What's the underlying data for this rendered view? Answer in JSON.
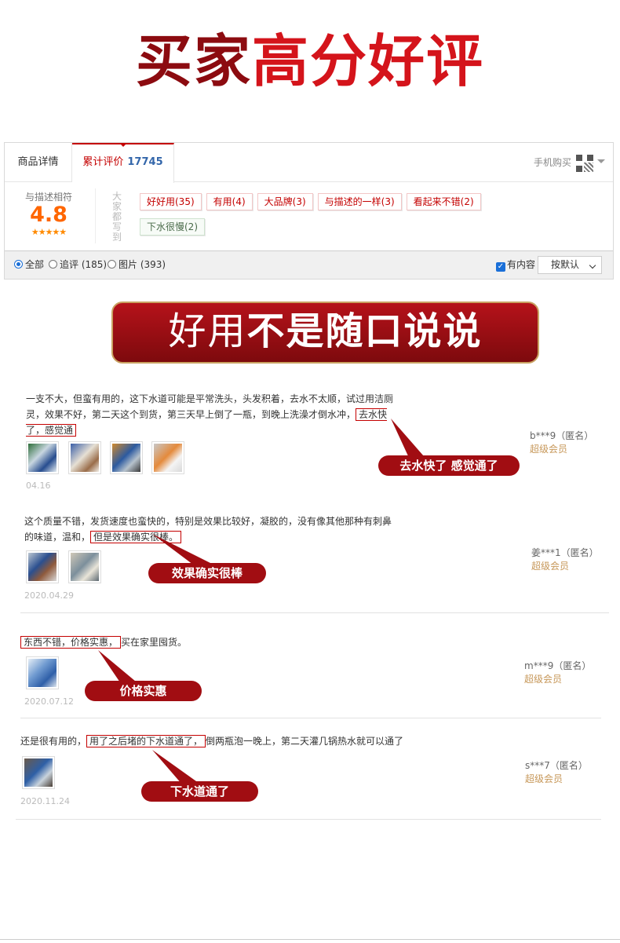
{
  "headline": {
    "part1": "买家",
    "part2": "高分好评"
  },
  "tabs": {
    "detail": "商品详情",
    "reviews_label": "累计评价",
    "reviews_count": "17745",
    "mobile_buy": "手机购买"
  },
  "summary": {
    "score_label": "与描述相符",
    "score": "4.8",
    "stars": "★★★★★",
    "side_label": "大家都写到",
    "tags": [
      "好好用(35)",
      "有用(4)",
      "大品牌(3)",
      "与描述的一样(3)",
      "看起来不错(2)"
    ],
    "neg_tags": [
      "下水很慢(2)"
    ]
  },
  "filter": {
    "all": "全部",
    "followup": "追评 (185)",
    "images": "图片 (393)",
    "has_content": "有内容",
    "sort": "按默认"
  },
  "banner": {
    "light": "好用",
    "bold": "不是随口说说"
  },
  "reviews": [
    {
      "text_a": "一支不大，但蛮有用的，这下水道可能是平常洗头，头发积着，去水不太顺，试过用洁厕灵，效果不好，第二天这个到货，第三天早上倒了一瓶，到晚上洗澡才倒水冲，",
      "highlight": "去水快了，感觉通",
      "text_b": "了。",
      "date": "04.16",
      "user": "b***9（匿名）",
      "level": "超级会员",
      "callout": "去水快了 感觉通了"
    },
    {
      "text_a": "这个质量不错，发货速度也蛮快的，特别是效果比较好，凝胶的，没有像其他那种有刺鼻的味道，温和，",
      "highlight": "但是效果确实很棒。",
      "text_b": "",
      "date": "2020.04.29",
      "user": "姜***1（匿名）",
      "level": "超级会员",
      "callout": "效果确实很棒"
    },
    {
      "text_a": "",
      "highlight": "东西不错，价格实惠，",
      "text_b": "买在家里囤货。",
      "date": "2020.07.12",
      "user": "m***9（匿名）",
      "level": "超级会员",
      "callout": "价格实惠"
    },
    {
      "text_a": "还是很有用的，",
      "highlight": "用了之后堵的下水道通了，",
      "text_b": "倒两瓶泡一晚上，第二天灌几锅热水就可以通了",
      "date": "2020.11.24",
      "user": "s***7（匿名）",
      "level": "超级会员",
      "callout": "下水道通了"
    }
  ],
  "colors": {
    "brand_red": "#c40000",
    "dark_red": "#8c0b10",
    "score_orange": "#ff6600",
    "vip_gold": "#c7985a"
  }
}
